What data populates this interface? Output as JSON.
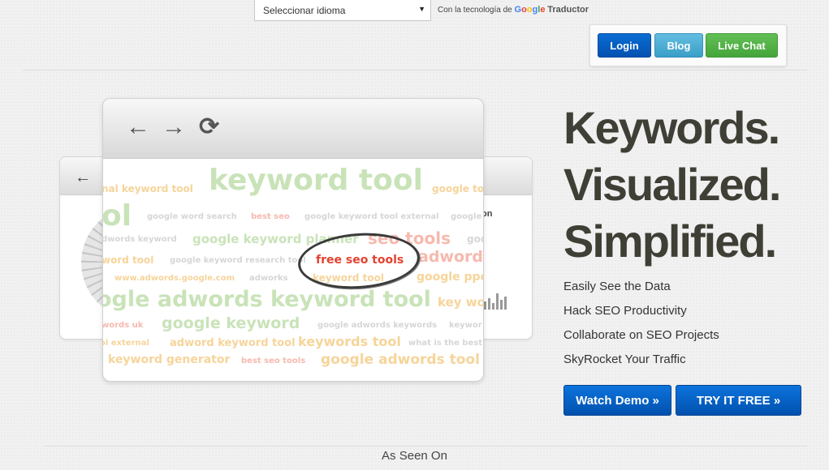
{
  "translate": {
    "select_label": "Seleccionar idioma",
    "powered_prefix": "Con la tecnología de",
    "google_letters": [
      "G",
      "o",
      "o",
      "g",
      "l",
      "e"
    ],
    "service_name": "Traductor"
  },
  "auth": {
    "login": "Login",
    "blog": "Blog",
    "live_chat": "Live Chat"
  },
  "colors": {
    "login_blue": "#0352b0",
    "blog_teal": "#3a9fc8",
    "chat_green": "#45a53a",
    "cta_blue": "#0251ae",
    "highlight_red": "#e34231"
  },
  "illustration": {
    "front_nav_icons": [
      "back-arrow-icon",
      "forward-arrow-icon",
      "refresh-icon"
    ],
    "back_fragment": "on",
    "highlighted_keyword": "free seo tools",
    "cloud": [
      "keyword tool",
      "nal keyword tool",
      "google to",
      "google word search",
      "best seo",
      "google keyword tool external",
      "google",
      "dwords keyword",
      "google keyword planner",
      "seo tools",
      "goo",
      "word tool",
      "google keyword research tool",
      "adword",
      "www.adwords.google.com",
      "adworks",
      "keyword tool",
      "google ppc",
      "ogle adwords keyword tool",
      "key wo",
      "words uk",
      "google keyword",
      "google adwords keywords",
      "keywor",
      "ol external",
      "adword keyword tool",
      "keywords tool",
      "what is the best s",
      "keyword generator",
      "best seo tools",
      "google adwords tool",
      "ol"
    ]
  },
  "hero": {
    "headline": [
      "Keywords.",
      "Visualized.",
      "Simplified."
    ],
    "features": [
      "Easily See the Data",
      "Hack SEO Productivity",
      "Collaborate on SEO Projects",
      "SkyRocket Your Traffic"
    ],
    "watch_demo": "Watch Demo »",
    "try_free": "TRY IT FREE »"
  },
  "footer": {
    "as_seen_on": "As Seen On"
  }
}
